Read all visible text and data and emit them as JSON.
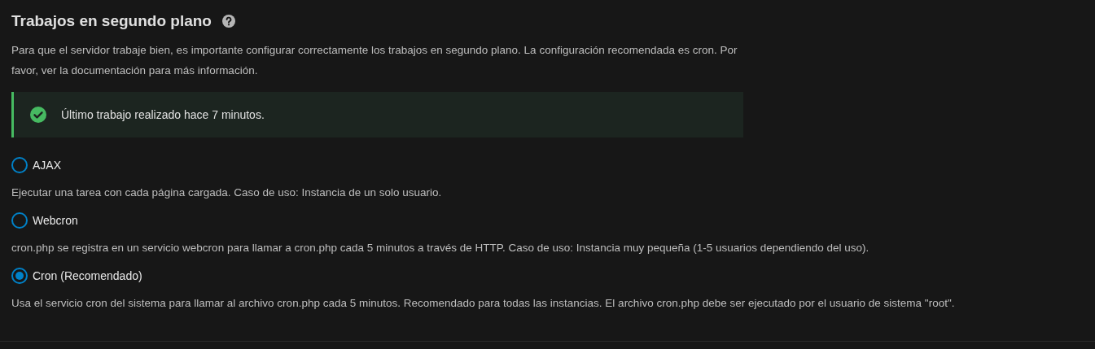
{
  "title": "Trabajos en segundo plano",
  "description": "Para que el servidor trabaje bien, es importante configurar correctamente los trabajos en segundo plano. La configuración recomendada es cron. Por favor, ver la documentación para más información.",
  "status": {
    "kind": "success",
    "text": "Último trabajo realizado hace 7 minutos."
  },
  "options": [
    {
      "label": "AJAX",
      "selected": false,
      "description": "Ejecutar una tarea con cada página cargada. Caso de uso: Instancia de un solo usuario."
    },
    {
      "label": "Webcron",
      "selected": false,
      "description": "cron.php se registra en un servicio webcron para llamar a cron.php cada 5 minutos a través de HTTP. Caso de uso: Instancia muy pequeña (1-5 usuarios dependiendo del uso)."
    },
    {
      "label": "Cron (Recomendado)",
      "selected": true,
      "description": "Usa el servicio cron del sistema para llamar al archivo cron.php cada 5 minutos. Recomendado para todas las instancias. El archivo cron.php debe ser ejecutado por el usuario de sistema \"root\"."
    }
  ]
}
